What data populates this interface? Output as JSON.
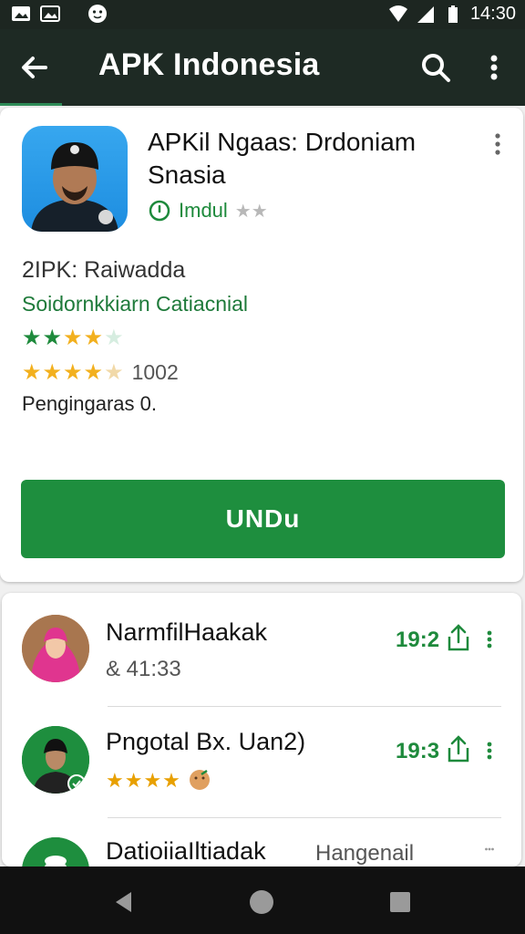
{
  "status_bar": {
    "time": "14:30",
    "icons": [
      "image-icon",
      "gallery-icon",
      "face-icon",
      "wifi-icon",
      "signal-icon",
      "battery-icon"
    ]
  },
  "app_bar": {
    "title": "APK Indonesia",
    "icons": [
      "back-arrow-icon",
      "search-icon",
      "more-vert-icon"
    ]
  },
  "featured": {
    "title": "APKil Ngaas: Drdoniam Snasia",
    "developer": "Imdul",
    "dev_stars": "★★",
    "subtitle": "2IPK: Raiwadda",
    "category": "Soidornkkiarn Catiacnial",
    "rating_stars": "★★★★★",
    "rating_stars_2": "★★★★★",
    "review_count": "1002",
    "installs": "Pengingaras 0.",
    "install_button": "UNDu",
    "colors": {
      "accent_green": "#1e8e3e",
      "app_bar": "#1e2a24",
      "star_yellow": "#f2b01e",
      "star_green": "#1e8a3c"
    }
  },
  "list": [
    {
      "name": "NarmfilHaakak",
      "subtitle": "& 41:33",
      "size": "19:2"
    },
    {
      "name": "Pngotal Bx. Uan2)",
      "rating": "★★★★",
      "size": "19:3"
    },
    {
      "name": "DatioiiaIltiadak",
      "date": "Hangenail"
    }
  ]
}
